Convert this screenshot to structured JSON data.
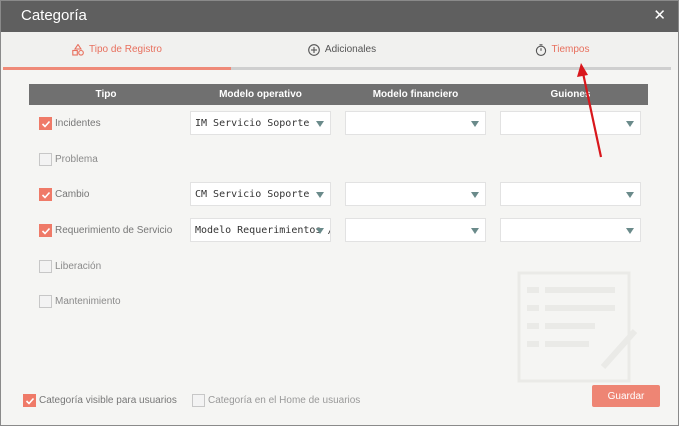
{
  "dialog": {
    "title": "Categoría",
    "close_glyph": "✕"
  },
  "tabs": [
    {
      "label": "Tipo de Registro",
      "icon": "shapes-icon",
      "active": true
    },
    {
      "label": "Adicionales",
      "icon": "plus-circle-icon",
      "active": false
    },
    {
      "label": "Tiempos",
      "icon": "stopwatch-icon",
      "active": false
    }
  ],
  "table": {
    "headers": [
      "Tipo",
      "Modelo operativo",
      "Modelo financiero",
      "Guiones"
    ],
    "rows": [
      {
        "label": "Incidentes",
        "checked": true,
        "operativo": "IM Servicio Soporte",
        "financiero": "",
        "guiones": ""
      },
      {
        "label": "Problema",
        "checked": false
      },
      {
        "label": "Cambio",
        "checked": true,
        "operativo": "CM Servicio Soporte",
        "financiero": "",
        "guiones": ""
      },
      {
        "label": "Requerimiento de Servicio",
        "checked": true,
        "operativo": "Modelo Requerimientos / G",
        "financiero": "",
        "guiones": ""
      },
      {
        "label": "Liberación",
        "checked": false
      },
      {
        "label": "Mantenimiento",
        "checked": false
      }
    ]
  },
  "footer": {
    "visible_users": {
      "label": "Categoría visible para usuarios",
      "checked": true
    },
    "home_users": {
      "label": "Categoría en el Home de usuarios",
      "checked": false
    },
    "save_label": "Guardar"
  },
  "colors": {
    "accent": "#ee8574",
    "titlebar": "#5f5f5f",
    "table_header": "#707070",
    "annotation_arrow": "#d9171c"
  }
}
